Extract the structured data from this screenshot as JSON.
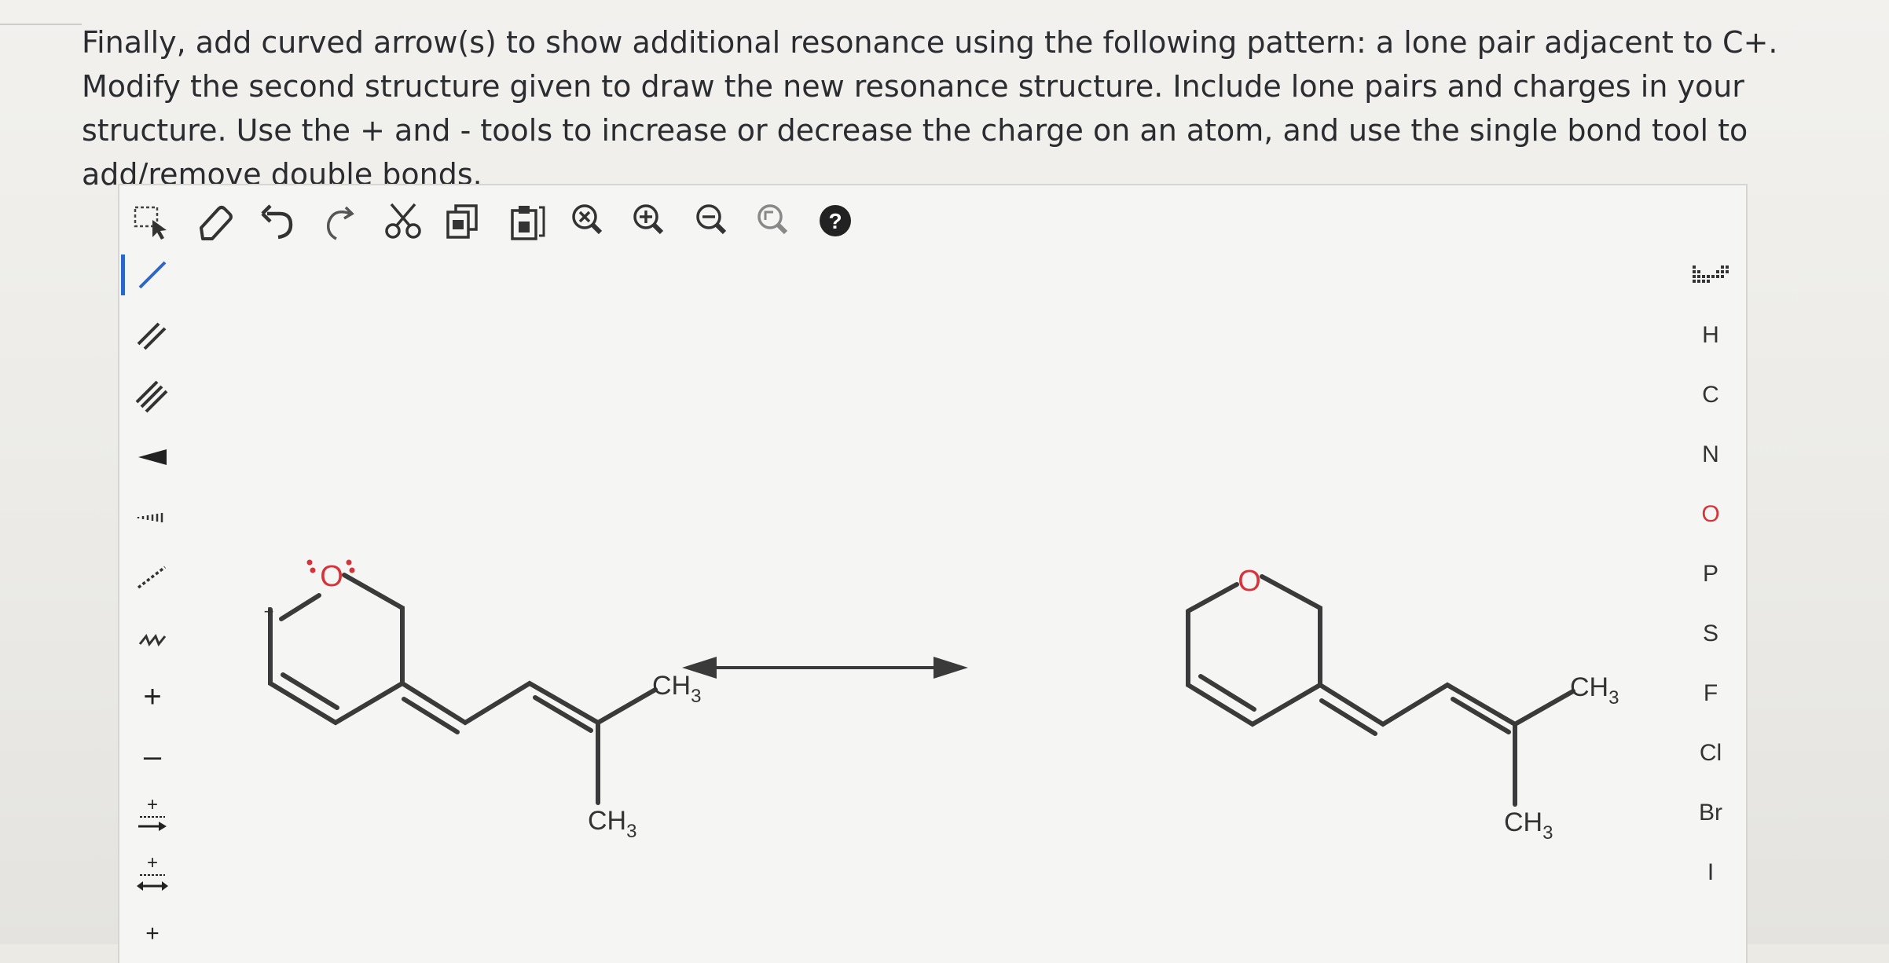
{
  "question": {
    "text": "Finally, add curved arrow(s) to show additional resonance using the following pattern: a lone pair adjacent to C+. Modify the second structure given to draw the new resonance structure. Include lone pairs and charges in your structure. Use the + and - tools to increase or decrease the charge on an atom, and use the single bond tool to add/remove double bonds."
  },
  "toolbar": {
    "icons": [
      "select-icon",
      "eraser-icon",
      "undo-icon",
      "redo-icon",
      "cut-icon",
      "copy-icon",
      "paste-icon",
      "clear-icon",
      "zoom-in-icon",
      "zoom-out-icon",
      "zoom-fit-icon",
      "help-icon"
    ],
    "help_label": "?"
  },
  "left_tools": {
    "icons": [
      "single-bond-icon",
      "double-bond-icon",
      "triple-bond-icon",
      "wedge-bond-icon",
      "hash-bond-icon",
      "dashed-bond-icon",
      "wavy-bond-icon",
      "plus-charge-icon",
      "minus-charge-icon",
      "radical-plus-arrow-icon",
      "resonance-arrow-icon",
      "plus-more-icon"
    ],
    "plus_label": "+",
    "minus_label": "–"
  },
  "elements": {
    "grid_icon": "periodic-table-icon",
    "list": [
      "H",
      "C",
      "N",
      "O",
      "P",
      "S",
      "F",
      "Cl",
      "Br",
      "I"
    ]
  },
  "molecule_left": {
    "oxygen": "O",
    "charge": "+",
    "ch3_top": "CH",
    "ch3_top_sub": "3",
    "ch3_bottom": "CH",
    "ch3_bottom_sub": "3"
  },
  "molecule_right": {
    "oxygen": "O",
    "ch3_top": "CH",
    "ch3_top_sub": "3",
    "ch3_bottom": "CH",
    "ch3_bottom_sub": "3"
  },
  "colors": {
    "oxygen": "#d8333b",
    "bond": "#3a3a3a",
    "active_tool": "#2b67c9"
  }
}
